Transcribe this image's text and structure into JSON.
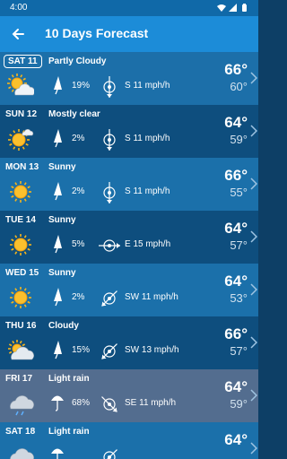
{
  "status_bar": {
    "time": "4:00"
  },
  "app_bar": {
    "title": "10 Days Forecast"
  },
  "days": [
    {
      "day": "SAT 11",
      "condition": "Partly Cloudy",
      "icon": "partly-cloudy-icon",
      "precip_icon": "umbrella-closed-icon",
      "precip": "19%",
      "wind": "S 11 mph/h",
      "wind_dir": "S",
      "high": "66°",
      "low": "60°",
      "bg": "#1c6fa9",
      "selected": true
    },
    {
      "day": "SUN 12",
      "condition": "Mostly clear",
      "icon": "mostly-clear-icon",
      "precip_icon": "umbrella-closed-icon",
      "precip": "2%",
      "wind": "S 11 mph/h",
      "wind_dir": "S",
      "high": "64°",
      "low": "59°",
      "bg": "#0e4e7e",
      "selected": false
    },
    {
      "day": "MON 13",
      "condition": "Sunny",
      "icon": "sun-icon",
      "precip_icon": "umbrella-closed-icon",
      "precip": "2%",
      "wind": "S 11 mph/h",
      "wind_dir": "S",
      "high": "66°",
      "low": "55°",
      "bg": "#1b70aa",
      "selected": false
    },
    {
      "day": "TUE 14",
      "condition": "Sunny",
      "icon": "sun-icon",
      "precip_icon": "umbrella-closed-icon",
      "precip": "5%",
      "wind": "E 15 mph/h",
      "wind_dir": "E",
      "high": "64°",
      "low": "57°",
      "bg": "#0e4e7e",
      "selected": false
    },
    {
      "day": "WED 15",
      "condition": "Sunny",
      "icon": "sun-icon",
      "precip_icon": "umbrella-closed-icon",
      "precip": "2%",
      "wind": "SW 11 mph/h",
      "wind_dir": "SW",
      "high": "64°",
      "low": "53°",
      "bg": "#1b70aa",
      "selected": false
    },
    {
      "day": "THU 16",
      "condition": "Cloudy",
      "icon": "cloudy-icon",
      "precip_icon": "umbrella-closed-icon",
      "precip": "15%",
      "wind": "SW 13 mph/h",
      "wind_dir": "SW",
      "high": "66°",
      "low": "57°",
      "bg": "#0e4e7e",
      "selected": false
    },
    {
      "day": "FRI 17",
      "condition": "Light rain",
      "icon": "light-rain-icon",
      "precip_icon": "umbrella-open-icon",
      "precip": "68%",
      "wind": "SE 11 mph/h",
      "wind_dir": "SE",
      "high": "64°",
      "low": "59°",
      "bg": "#536d8f",
      "selected": false
    },
    {
      "day": "SAT 18",
      "condition": "Light rain",
      "icon": "light-rain-icon",
      "precip_icon": "umbrella-open-icon",
      "precip": "",
      "wind": "",
      "wind_dir": "SW",
      "high": "64°",
      "low": "",
      "bg": "#1b70aa",
      "selected": false
    }
  ]
}
